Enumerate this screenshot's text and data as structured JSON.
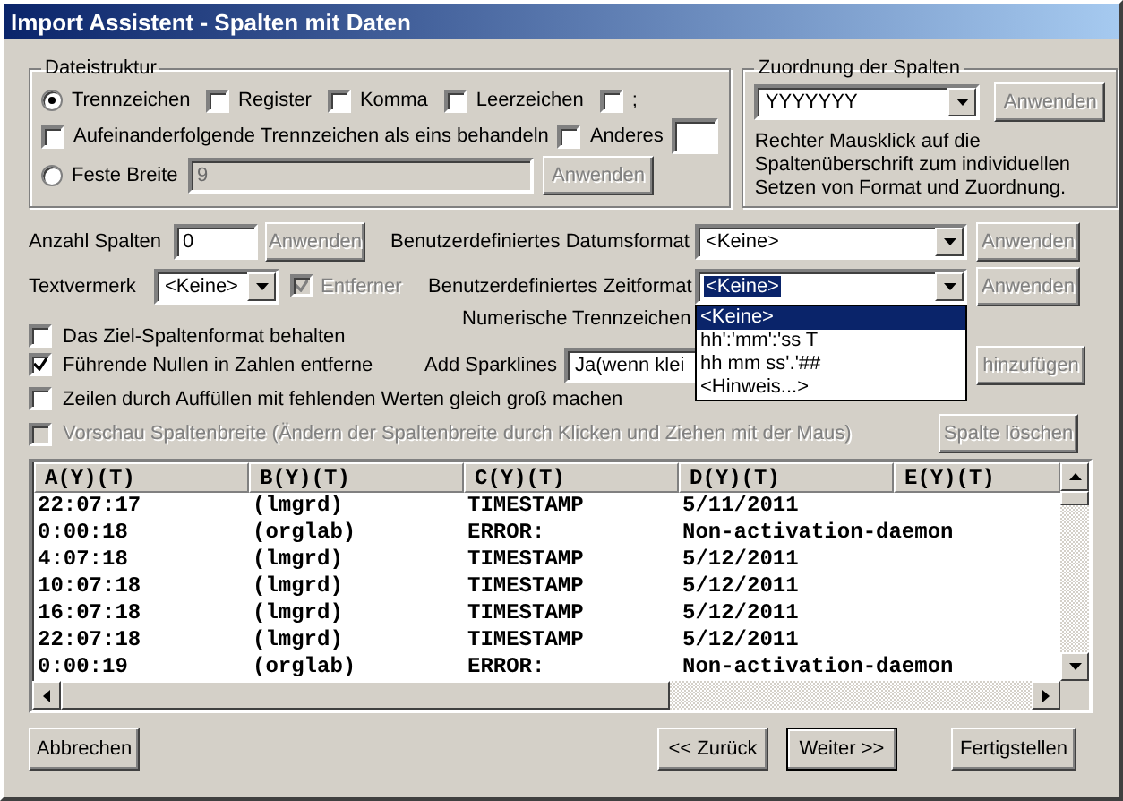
{
  "window": {
    "title": "Import Assistent - Spalten mit Daten"
  },
  "file_structure": {
    "legend": "Dateistruktur",
    "delimited": {
      "label": "Trennzeichen",
      "selected": true
    },
    "delimiters": [
      {
        "label": "Register",
        "checked": false
      },
      {
        "label": "Komma",
        "checked": false
      },
      {
        "label": "Leerzeichen",
        "checked": false
      },
      {
        "label": ";",
        "checked": false
      }
    ],
    "merge": {
      "label": "Aufeinanderfolgende Trennzeichen als eins behandeln",
      "checked": false
    },
    "other": {
      "label": "Anderes",
      "checked": false
    },
    "fixed": {
      "label": "Feste Breite",
      "selected": false,
      "value": "9"
    },
    "apply_button": {
      "label": "Anwenden",
      "disabled": true
    }
  },
  "column_mapping": {
    "legend": "Zuordnung der Spalten",
    "value": "YYYYYYY",
    "apply_button": {
      "label": "Anwenden",
      "disabled": true
    },
    "hint": "Rechter Mausklick auf die Spaltenüberschrift zum individuellen Setzen von Format und Zuordnung."
  },
  "column_count": {
    "label": "Anzahl Spalten",
    "value": "0",
    "button": {
      "label": "Anwenden",
      "disabled": true
    }
  },
  "date_format": {
    "label": "Benutzerdefiniertes Datumsformat",
    "value": "<Keine>",
    "button": {
      "label": "Anwenden",
      "disabled": true
    }
  },
  "text_qualifier": {
    "label": "Textvermerk",
    "value": "<Keine>",
    "remove": {
      "label": "Entferner",
      "checked": true,
      "disabled": true
    }
  },
  "time_format": {
    "label": "Benutzerdefiniertes Zeitformat",
    "value": "<Keine>",
    "button": {
      "label": "Anwenden",
      "disabled": true
    },
    "expanded": true,
    "items": [
      {
        "label": "<Keine>",
        "selected": true
      },
      {
        "label": "hh':'mm':'ss T",
        "selected": false
      },
      {
        "label": "hh mm ss'.'##",
        "selected": false
      },
      {
        "label": "<Hinweis...>",
        "selected": false
      }
    ]
  },
  "numeric_separators": {
    "label": "Numerische Trennzeichen"
  },
  "sparklines": {
    "label": "Add Sparklines",
    "value": "Ja(wenn klei",
    "button": {
      "label": "hinzufügen",
      "disabled": true
    }
  },
  "checkboxes": [
    {
      "label": "Das Ziel-Spaltenformat behalten",
      "checked": false,
      "disabled": false
    },
    {
      "label": "Führende Nullen in Zahlen entferne",
      "checked": true,
      "disabled": false
    },
    {
      "label": "Zeilen durch Auffüllen mit fehlenden Werten gleich groß machen",
      "checked": false,
      "disabled": false
    },
    {
      "label": "Vorschau Spaltenbreite (Ändern der Spaltenbreite durch Klicken und Ziehen mit der Maus)",
      "checked": false,
      "disabled": true
    }
  ],
  "delete_button": {
    "label": "Spalte löschen",
    "disabled": true
  },
  "table": {
    "columns": [
      "A(Y)(T)",
      "B(Y)(T)",
      "C(Y)(T)",
      "D(Y)(T)",
      "E(Y)(T)"
    ],
    "rows": [
      [
        "22:07:17",
        "(lmgrd)",
        "TIMESTAMP",
        "5/11/2011"
      ],
      [
        "0:00:18",
        "(orglab)",
        "ERROR:",
        "Non-activation-daemon"
      ],
      [
        "4:07:18",
        "(lmgrd)",
        "TIMESTAMP",
        "5/12/2011"
      ],
      [
        "10:07:18",
        "(lmgrd)",
        "TIMESTAMP",
        "5/12/2011"
      ],
      [
        "16:07:18",
        "(lmgrd)",
        "TIMESTAMP",
        "5/12/2011"
      ],
      [
        "22:07:18",
        "(lmgrd)",
        "TIMESTAMP",
        "5/12/2011"
      ],
      [
        "0:00:19",
        "(orglab)",
        "ERROR:",
        "Non-activation-daemon"
      ]
    ]
  },
  "buttons": [
    {
      "label": "Abbrechen",
      "default": false
    },
    {
      "label": "<< Zurück",
      "default": false
    },
    {
      "label": "Weiter >>",
      "default": true
    },
    {
      "label": "Fertigstellen",
      "default": false
    }
  ]
}
